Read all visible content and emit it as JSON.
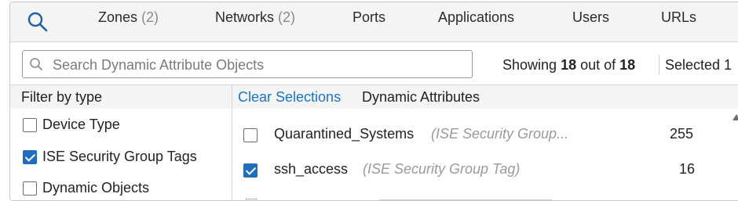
{
  "tabs": [
    {
      "label": "Zones",
      "count": "(2)"
    },
    {
      "label": "Networks",
      "count": "(2)"
    },
    {
      "label": "Ports",
      "count": ""
    },
    {
      "label": "Applications",
      "count": ""
    },
    {
      "label": "Users",
      "count": ""
    },
    {
      "label": "URLs",
      "count": ""
    }
  ],
  "search": {
    "placeholder": "Search Dynamic Attribute Objects"
  },
  "showing": {
    "prefix": "Showing",
    "shown": "18",
    "middle": "out of",
    "total": "18"
  },
  "selected_label": "Selected 1",
  "filter": {
    "heading": "Filter by type",
    "options": [
      {
        "label": "Device Type",
        "checked": false
      },
      {
        "label": "ISE Security Group Tags",
        "checked": true
      },
      {
        "label": "Dynamic Objects",
        "checked": false
      }
    ]
  },
  "list": {
    "clear_label": "Clear Selections",
    "heading": "Dynamic Attributes",
    "rows": [
      {
        "name": "Quarantined_Systems",
        "type": "(ISE Security Group...",
        "count": "255",
        "checked": false
      },
      {
        "name": "ssh_access",
        "type": "(ISE Security Group Tag)",
        "count": "16",
        "checked": true
      }
    ]
  },
  "colors": {
    "accent": "#1f6dbf",
    "link": "#1a73c7",
    "muted": "#9a9a9a"
  }
}
